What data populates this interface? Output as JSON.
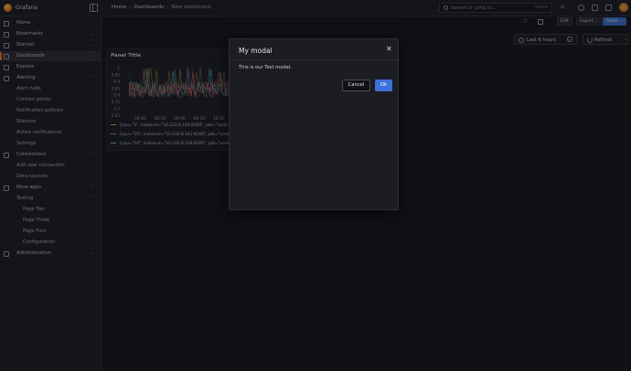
{
  "app": {
    "brand": "Grafana"
  },
  "breadcrumbs": [
    "Home",
    "Dashboards",
    "New dashboard"
  ],
  "search": {
    "placeholder": "Search or jump to...",
    "shortcut": "ctrl+k"
  },
  "toolbar": {
    "edit": "Edit",
    "export": "Export",
    "share": "Share"
  },
  "time_picker": {
    "label": "Last 6 hours",
    "refresh": "Refresh"
  },
  "sidebar": {
    "items": [
      {
        "label": "Home",
        "icon": "home-icon"
      },
      {
        "label": "Bookmarks",
        "icon": "bookmark-icon",
        "chevron": "⌄"
      },
      {
        "label": "Starred",
        "icon": "star-icon",
        "chevron": "⌄"
      },
      {
        "label": "Dashboards",
        "icon": "dashboards-icon",
        "chevron": "⌄",
        "active": true
      },
      {
        "label": "Explore",
        "icon": "compass-icon",
        "chevron": "⌄"
      },
      {
        "label": "Alerting",
        "icon": "bell-icon",
        "chevron": "⌃"
      },
      {
        "label": "Alert rules"
      },
      {
        "label": "Contact points"
      },
      {
        "label": "Notification policies"
      },
      {
        "label": "Silences"
      },
      {
        "label": "Active notifications"
      },
      {
        "label": "Settings"
      },
      {
        "label": "Connections",
        "icon": "connections-icon",
        "chevron": "⌃"
      },
      {
        "label": "Add new connection"
      },
      {
        "label": "Data sources"
      },
      {
        "label": "More apps",
        "icon": "apps-icon",
        "chevron": "⌃"
      },
      {
        "label": "Testing",
        "chevron": "⌃"
      },
      {
        "label": "Page Two"
      },
      {
        "label": "Page Three"
      },
      {
        "label": "Page Four"
      },
      {
        "label": "Configuration"
      },
      {
        "label": "Administration",
        "icon": "admin-gear-icon",
        "chevron": "⌄"
      }
    ]
  },
  "panel": {
    "title": "Panel Title",
    "y_ticks": [
      "1",
      "0.95",
      "0.9",
      "0.85",
      "0.8",
      "0.75",
      "0.7",
      "0.65"
    ],
    "x_ticks": [
      "08:00",
      "08:30",
      "09:00",
      "09:30",
      "10:00"
    ],
    "legend": [
      {
        "label": "{cpu=\"1\", instance=\"10.232.8.164:8160\", job=\"node-ex",
        "color": "#eab839"
      },
      {
        "label": "{cpu=\"10\", instance=\"10.232.8.161:8160\", job=\"node-ex",
        "color": "#ef843c"
      },
      {
        "label": "{cpu=\"10\", instance=\"10.232.8.164:8160\", job=\"node-ex",
        "color": "#6ed0e0"
      }
    ]
  },
  "modal": {
    "title": "My modal",
    "body": "This is our Test modal.",
    "cancel": "Cancel",
    "ok": "Ok"
  }
}
